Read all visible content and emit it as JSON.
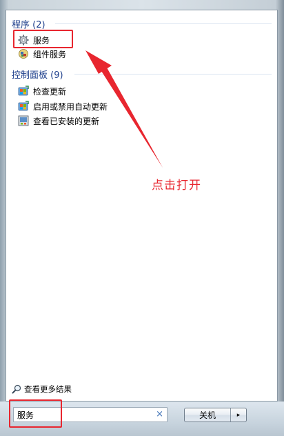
{
  "programs": {
    "header": "程序 (2)",
    "items": [
      {
        "label": "服务",
        "icon": "gear-icon"
      },
      {
        "label": "组件服务",
        "icon": "component-services-icon"
      }
    ]
  },
  "control_panel": {
    "header": "控制面板 (9)",
    "items": [
      {
        "label": "检查更新",
        "icon": "windows-update-icon"
      },
      {
        "label": "启用或禁用自动更新",
        "icon": "windows-update-icon"
      },
      {
        "label": "查看已安装的更新",
        "icon": "installed-updates-icon"
      }
    ]
  },
  "see_more": {
    "label": "查看更多结果",
    "icon": "search-icon"
  },
  "search": {
    "value": "服务",
    "clear_glyph": "×"
  },
  "shutdown": {
    "label": "关机",
    "arrow": "▸"
  },
  "annotation": {
    "text": "点击打开",
    "color": "#e8262f"
  }
}
